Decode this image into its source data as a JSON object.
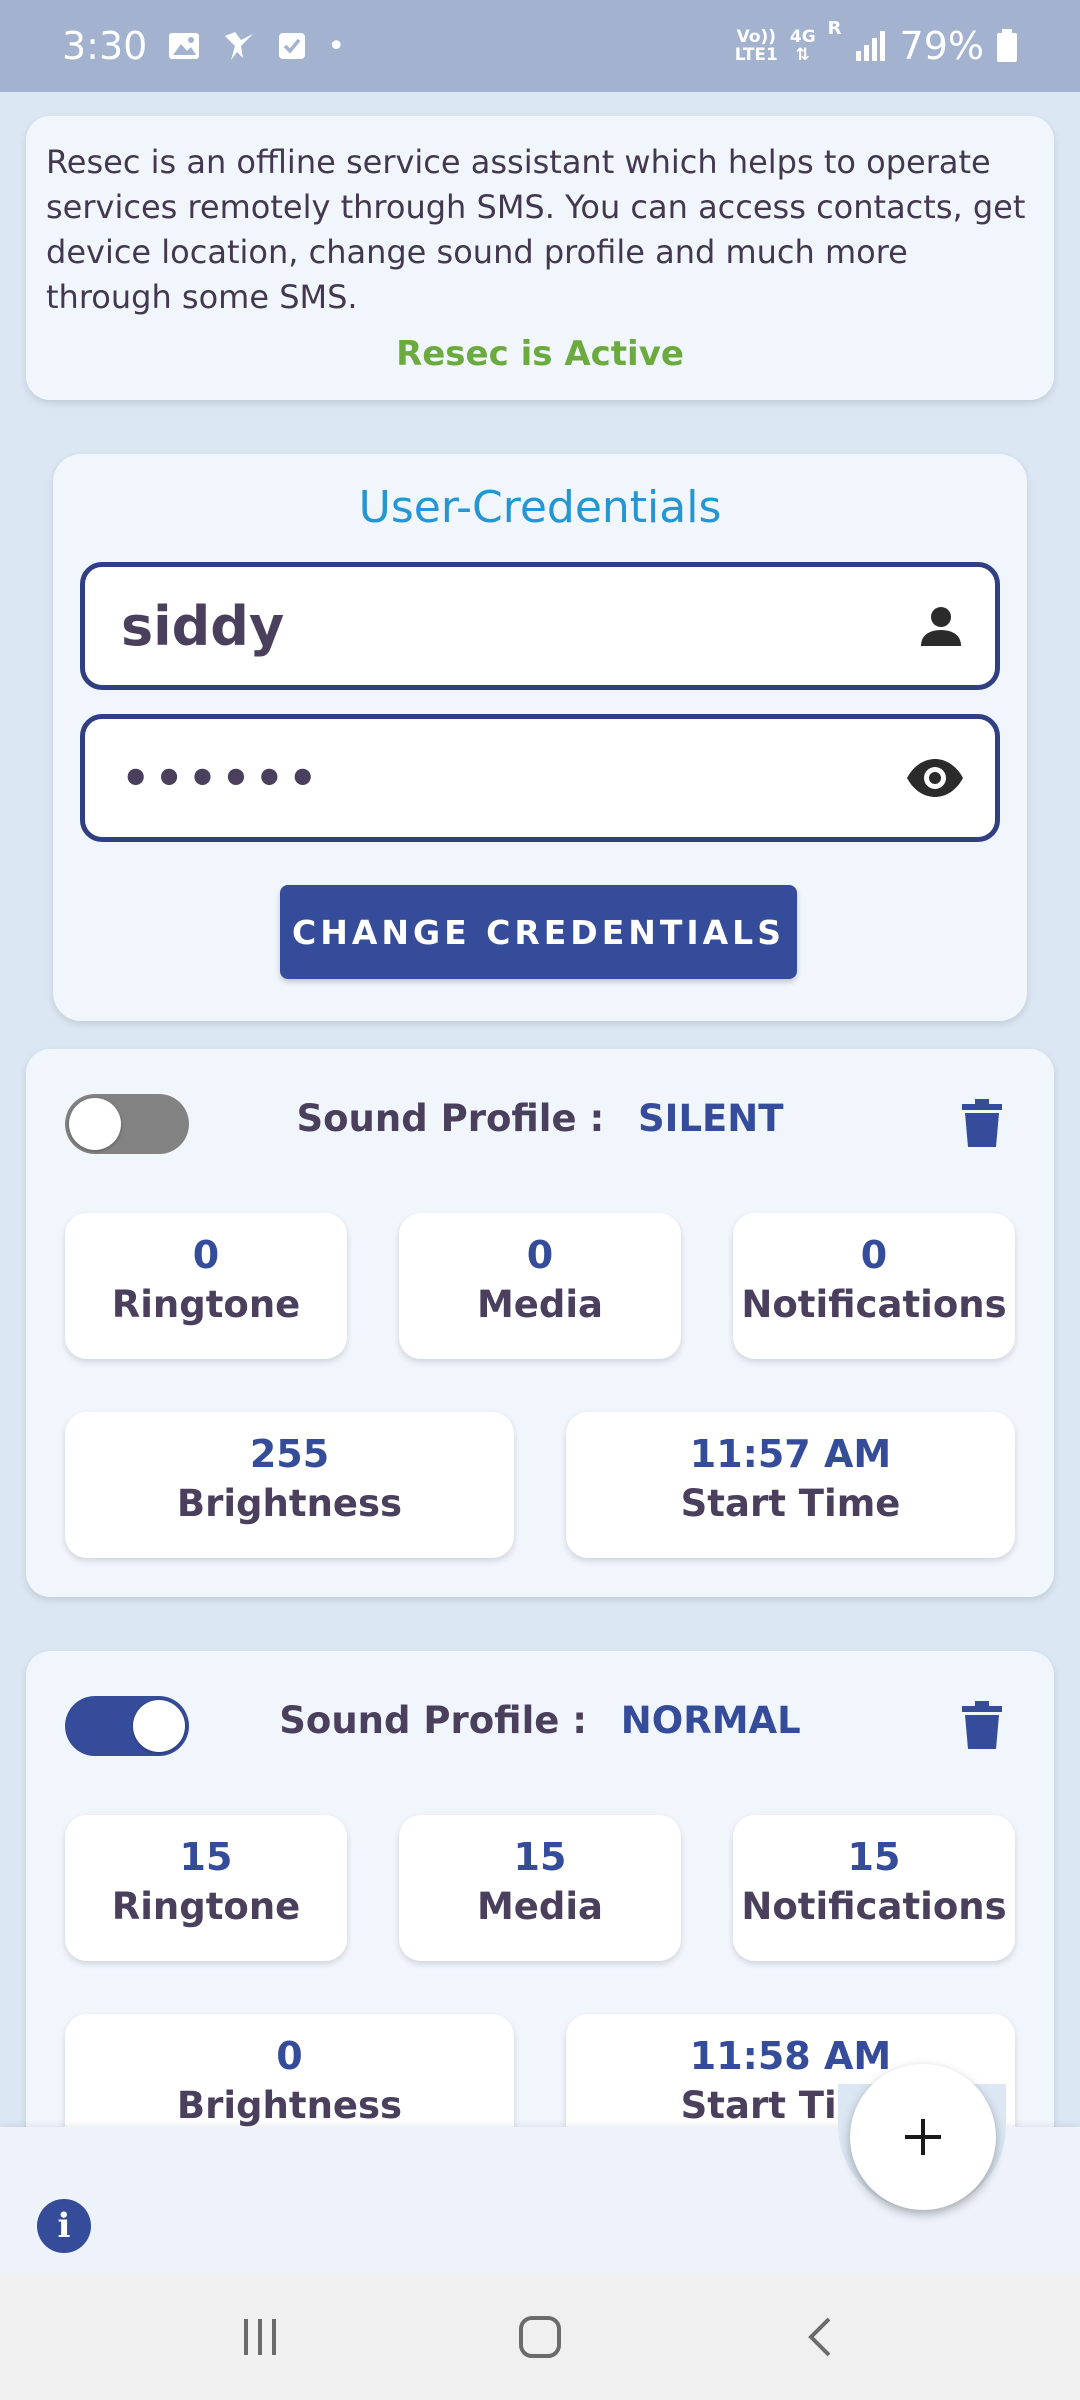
{
  "status_bar": {
    "time": "3:30",
    "dot": "•",
    "volte_top": "Vo))",
    "volte_bottom": "LTE1",
    "network": "4G",
    "roaming": "R",
    "battery": "79%"
  },
  "info": {
    "description": "Resec is an offline service assistant which helps to operate services remotely through SMS. You can access contacts, get device location, change sound profile and much more through some SMS.",
    "status": "Resec is Active"
  },
  "credentials": {
    "title": "User-Credentials",
    "username": "siddy",
    "password_masked": "••••••",
    "change_button": "CHANGE CREDENTIALS"
  },
  "profiles": [
    {
      "enabled": false,
      "label": "Sound Profile :",
      "mode": "SILENT",
      "ringtone": "0",
      "ringtone_label": "Ringtone",
      "media": "0",
      "media_label": "Media",
      "notifications": "0",
      "notifications_label": "Notifications",
      "brightness": "255",
      "brightness_label": "Brightness",
      "start_time": "11:57 AM",
      "start_time_label": "Start Time"
    },
    {
      "enabled": true,
      "label": "Sound Profile :",
      "mode": "NORMAL",
      "ringtone": "15",
      "ringtone_label": "Ringtone",
      "media": "15",
      "media_label": "Media",
      "notifications": "15",
      "notifications_label": "Notifications",
      "brightness": "0",
      "brightness_label": "Brightness",
      "start_time": "11:58 AM",
      "start_time_label": "Start Time"
    }
  ],
  "bottom_bar": {
    "info_icon": "i",
    "fab_icon": "plus-icon"
  },
  "colors": {
    "primary": "#354c9b",
    "active_green": "#6aaa3e",
    "title_blue": "#2596d4",
    "background": "#dbe7f3",
    "card": "#f1f6fd"
  }
}
